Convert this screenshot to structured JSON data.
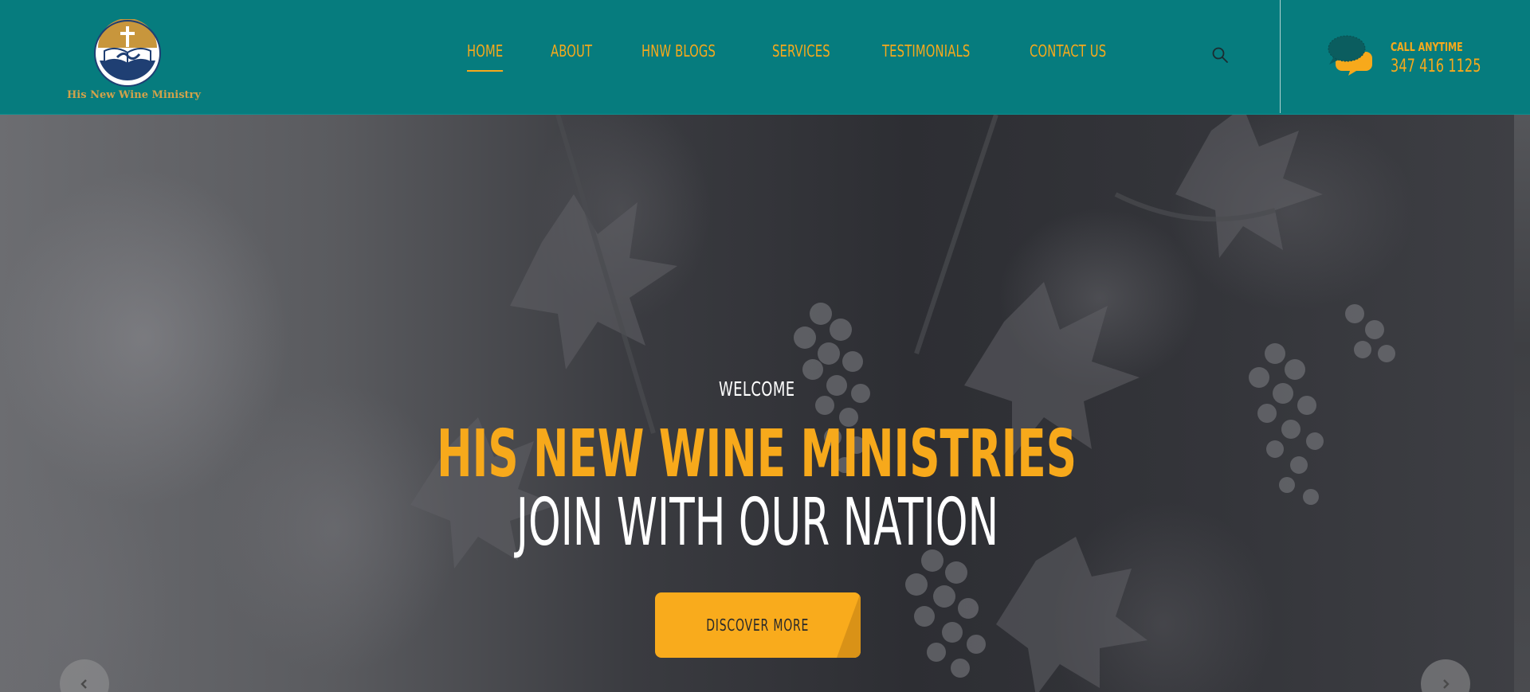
{
  "brand": {
    "name": "His New Wine Ministry",
    "logo_icon": "cross-bible-river-logo",
    "colors": {
      "header_bg": "#067c7e",
      "accent": "#f7a91b",
      "logo_gold": "#d2a24a",
      "logo_navy": "#1f3f73"
    }
  },
  "nav": {
    "items": [
      {
        "label": "HOME",
        "active": true
      },
      {
        "label": "ABOUT",
        "active": false
      },
      {
        "label": "HNW BLOGS",
        "active": false
      },
      {
        "label": "SERVICES",
        "active": false
      },
      {
        "label": "TESTIMONIALS",
        "active": false
      },
      {
        "label": "CONTACT US",
        "active": false
      }
    ],
    "search_icon": "search-icon"
  },
  "contact": {
    "icon": "chat-bubbles-icon",
    "label": "CALL ANYTIME",
    "phone": "347 416 1125"
  },
  "hero": {
    "kicker": "WELCOME",
    "title": "HIS NEW WINE MINISTRIES",
    "subtitle": "JOIN WITH OUR NATION",
    "cta_label": "DISCOVER MORE",
    "prev_icon": "chevron-left-icon",
    "next_icon": "chevron-right-icon",
    "background": "grayscale photo of grape vines"
  }
}
